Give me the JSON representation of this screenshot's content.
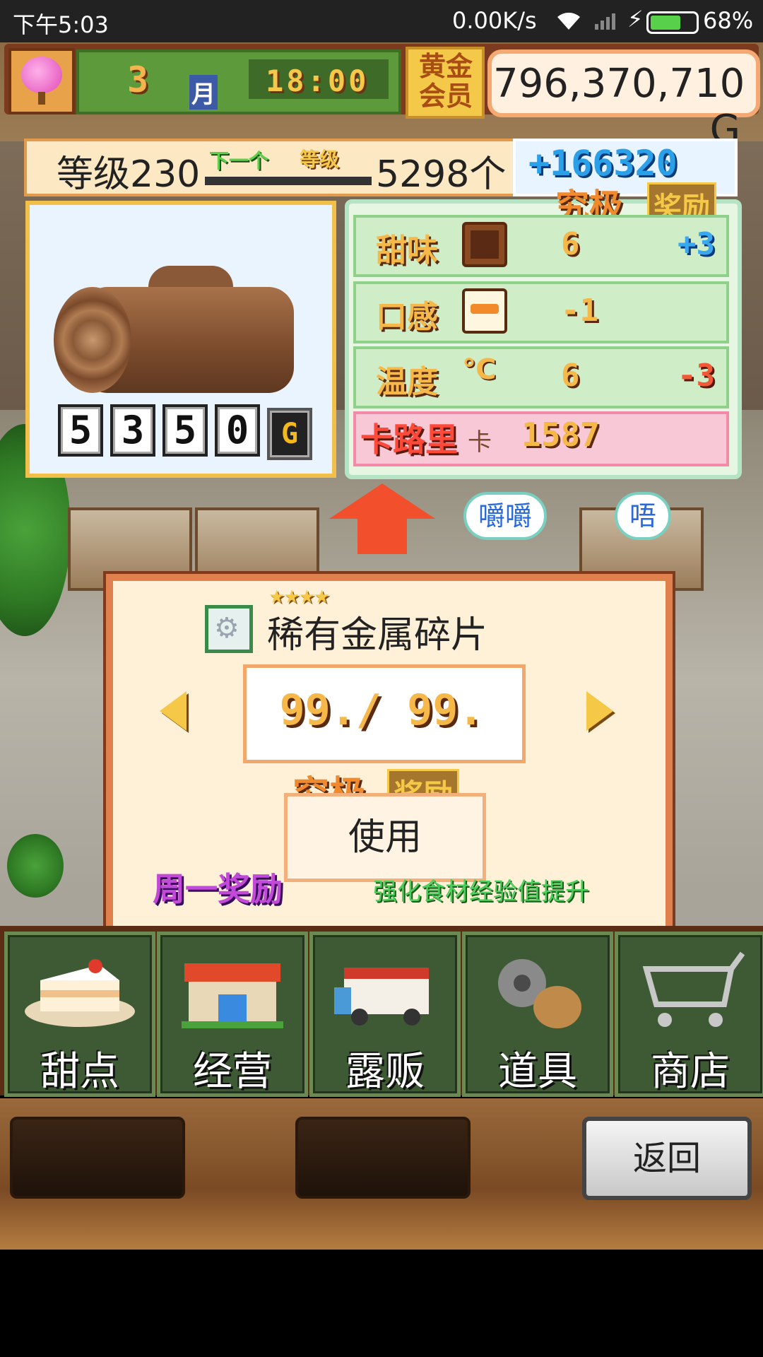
{
  "status_bar": {
    "time": "下午5:03",
    "network_speed": "0.00K/s",
    "battery_percent": "68%",
    "battery_level": 0.68,
    "icons": [
      "wifi-icon",
      "signal-icon",
      "charging-bolt-icon",
      "battery-icon"
    ]
  },
  "hud": {
    "month": "3",
    "month_label": "月",
    "time": "18:00",
    "gold_member_line1": "黄金",
    "gold_member_line2": "会员",
    "money": "796,370,710",
    "money_unit": "G"
  },
  "level": {
    "level_text": "等级230",
    "next_label": "下一个",
    "level_label": "等级",
    "count": "5298个",
    "bonus": "+166320"
  },
  "food": {
    "name_icon": "log-cake-icon",
    "price_digits": [
      "5",
      "3",
      "5",
      "0"
    ],
    "price_unit": "G"
  },
  "stats": {
    "ultimate_label": "究极",
    "reward_label": "奖励",
    "rows": [
      {
        "label": "甜味",
        "icon": "chocolate-icon",
        "value": "6",
        "bonus": "+3",
        "bonus_type": "pos"
      },
      {
        "label": "口感",
        "icon": "burger-icon",
        "value": "-1",
        "bonus": "",
        "bonus_type": "none"
      },
      {
        "label": "温度",
        "icon": "celsius-icon",
        "icon_text": "℃",
        "value": "6",
        "bonus": "-3",
        "bonus_type": "neg"
      }
    ],
    "calorie_label": "卡路里",
    "calorie_unit": "卡",
    "calorie_value": "1587"
  },
  "bubbles": {
    "left": "嚼嚼",
    "right": "唔"
  },
  "dialog": {
    "stars": "★★★★",
    "item_name": "稀有金属碎片",
    "quantity": "99./ 99.",
    "ultimate_label": "究极",
    "reward_label": "奖励",
    "use_button": "使用",
    "weekly_label": "周一奖励",
    "description": "强化食材经验值提升"
  },
  "menu": [
    {
      "label": "甜点",
      "icon": "cake-icon"
    },
    {
      "label": "经营",
      "icon": "shop-icon"
    },
    {
      "label": "露贩",
      "icon": "food-truck-icon"
    },
    {
      "label": "道具",
      "icon": "items-icon"
    },
    {
      "label": "商店",
      "icon": "shopping-cart-icon"
    }
  ],
  "bottom": {
    "back_button": "返回"
  },
  "colors": {
    "accent_orange": "#e0804c",
    "gold": "#f6c848",
    "menu_green": "#3e5a34",
    "positive_blue": "#3aa8f0",
    "negative_red": "#f25a36"
  }
}
